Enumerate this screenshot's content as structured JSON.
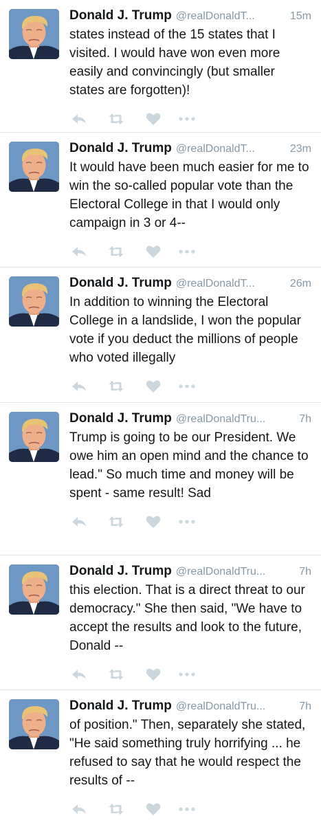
{
  "tweets": [
    {
      "name": "Donald J. Trump",
      "handle": "@realDonaldT...",
      "time": "15m",
      "text": "states instead of the 15 states that I visited. I would have won even more easily and convincingly (but smaller states are forgotten)!"
    },
    {
      "name": "Donald J. Trump",
      "handle": "@realDonaldT...",
      "time": "23m",
      "text": "It would have been much easier for me to win the so-called popular vote than the Electoral College in that I would only campaign in 3 or 4--"
    },
    {
      "name": "Donald J. Trump",
      "handle": "@realDonaldT...",
      "time": "26m",
      "text": "In addition to winning the Electoral College in a landslide, I won the popular vote if you deduct the millions of people who voted illegally"
    },
    {
      "name": "Donald J. Trump",
      "handle": "@realDonaldTru...",
      "time": "7h",
      "text": "Trump is going to be our President. We owe him an open mind and the chance to lead.\" So much time and money will be spent - same result! Sad"
    },
    {
      "name": "Donald J. Trump",
      "handle": "@realDonaldTru...",
      "time": "7h",
      "text": "this election. That is a direct threat to our democracy.\" She then said, \"We have to accept the results and look to the future, Donald --"
    },
    {
      "name": "Donald J. Trump",
      "handle": "@realDonaldTru...",
      "time": "7h",
      "text": "of position.\" Then, separately she stated, \"He said something truly horrifying ... he refused to say that he would respect the results of --"
    }
  ],
  "icons": {
    "avatar": "profile-photo",
    "reply": "reply-icon",
    "retweet": "retweet-icon",
    "like": "heart-icon",
    "more": "more-icon"
  },
  "colors": {
    "name": "#14171a",
    "secondary": "#8899a6",
    "action_icons": "#ccd6dd",
    "divider": "#e1e8ed"
  }
}
